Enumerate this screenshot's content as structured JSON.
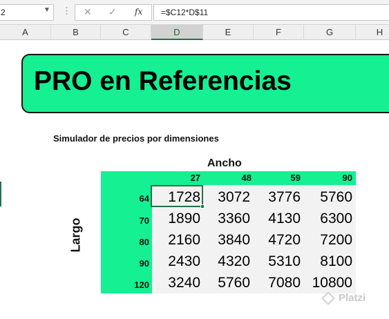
{
  "formula_bar": {
    "namebox": "2",
    "fx_label": "fx",
    "formula": "=$C12*D$11"
  },
  "columns": [
    "A",
    "B",
    "C",
    "D",
    "E",
    "F",
    "G",
    "H"
  ],
  "selected_column": "D",
  "title": "PRO en Referencias",
  "subtitle": "Simulador de precios por dimensiones",
  "table": {
    "ancho_label": "Ancho",
    "largo_label": "Largo",
    "ancho_values": [
      "27",
      "48",
      "59",
      "90"
    ],
    "largo_values": [
      "64",
      "70",
      "80",
      "90",
      "120"
    ],
    "rows": [
      [
        "1728",
        "3072",
        "3776",
        "5760"
      ],
      [
        "1890",
        "3360",
        "4130",
        "6300"
      ],
      [
        "2160",
        "3840",
        "4720",
        "7200"
      ],
      [
        "2430",
        "4320",
        "5310",
        "8100"
      ],
      [
        "3240",
        "5760",
        "7080",
        "10800"
      ]
    ]
  },
  "watermark": "Platzi",
  "colors": {
    "accent_green": "#14f092",
    "excel_green": "#217346"
  }
}
